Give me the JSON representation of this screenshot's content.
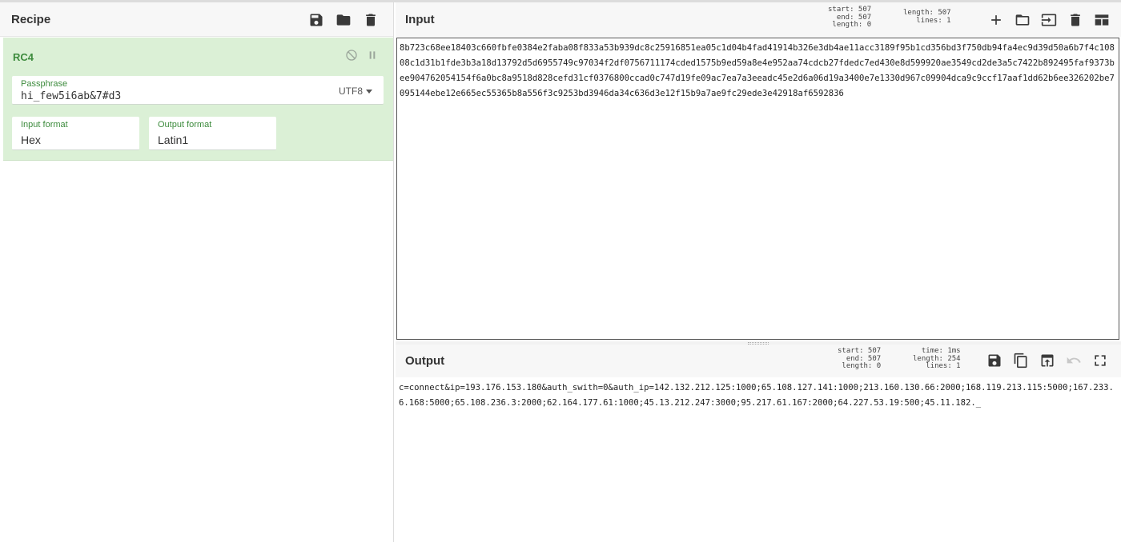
{
  "recipe": {
    "title": "Recipe",
    "operation": {
      "name": "RC4",
      "passphrase_label": "Passphrase",
      "passphrase_value": "hi_few5i6ab&7#d3",
      "passphrase_encoding": "UTF8",
      "input_format_label": "Input format",
      "input_format_value": "Hex",
      "output_format_label": "Output format",
      "output_format_value": "Latin1"
    }
  },
  "input": {
    "title": "Input",
    "stats": {
      "start": "start: 507",
      "end": "end: 507",
      "sel_length": "length:  0",
      "length": "length: 507",
      "lines": "lines:   1"
    },
    "text": "8b723c68ee18403c660fbfe0384e2faba08f833a53b939dc8c25916851ea05c1d04b4fad41914b326e3db4ae11acc3189f95b1cd356bd3f750db94fa4ec9d39d50a6b7f4c10808c1d31b1fde3b3a18d13792d5d6955749c97034f2df0756711174cded1575b9ed59a8e4e952aa74cdcb27fdedc7ed430e8d599920ae3549cd2de3a5c7422b892495faf9373bee904762054154f6a0bc8a9518d828cefd31cf0376800ccad0c747d19fe09ac7ea7a3eeadc45e2d6a06d19a3400e7e1330d967c09904dca9c9ccf17aaf1dd62b6ee326202be7095144ebe12e665ec55365b8a556f3c9253bd3946da34c636d3e12f15b9a7ae9fc29ede3e42918af6592836"
  },
  "output": {
    "title": "Output",
    "stats": {
      "start": "start: 507",
      "end": "end: 507",
      "sel_length": "length:  0",
      "time": "time:  1ms",
      "length": "length: 254",
      "lines": "lines:   1"
    },
    "text": "c=connect&ip=193.176.153.180&auth_swith=0&auth_ip=142.132.212.125:1000;65.108.127.141:1000;213.160.130.66:2000;168.119.213.115:5000;167.233.6.168:5000;65.108.236.3:2000;62.164.177.61:1000;45.13.212.247:3000;95.217.61.167:2000;64.227.53.19:500;45.11.182._"
  },
  "icons": [
    "save-icon",
    "folder-icon",
    "trash-icon",
    "disable-icon",
    "pause-icon",
    "plus-icon",
    "open-folder-icon",
    "input-file-icon",
    "layout-icon",
    "copy-icon",
    "replace-input-icon",
    "undo-icon",
    "fullscreen-icon"
  ]
}
